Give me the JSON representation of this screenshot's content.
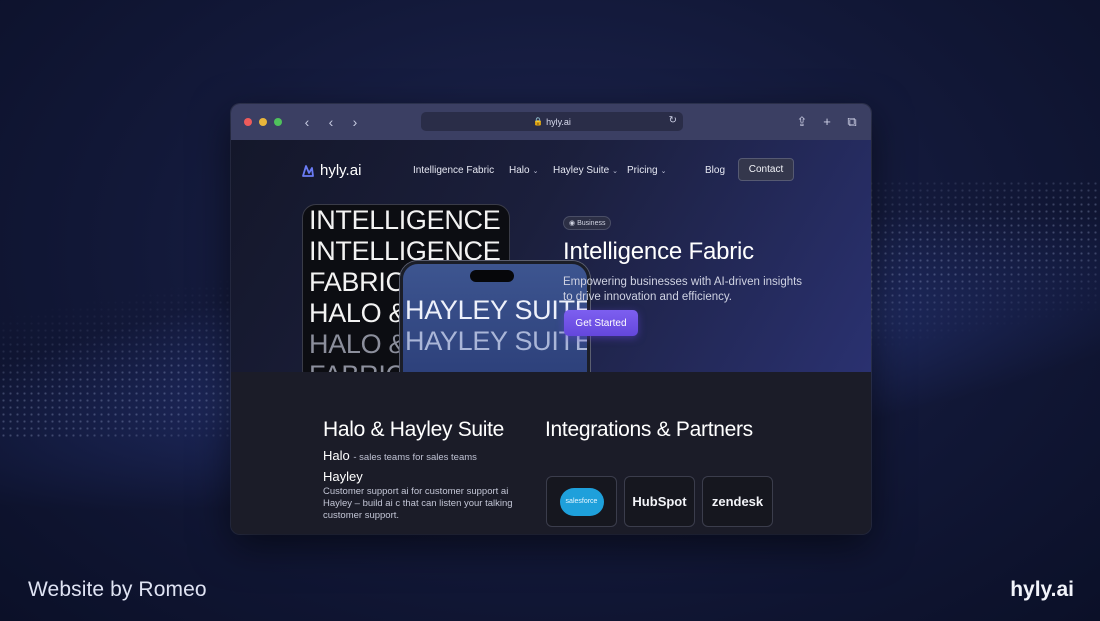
{
  "footer": {
    "credit": "Website by Romeo",
    "brand": "hyly.ai"
  },
  "browser": {
    "url": "hyly.ai",
    "controls": {
      "back": "‹",
      "prev": "‹",
      "next": "›",
      "reload": "↻",
      "share": "⇪",
      "new_tab": "+",
      "tabs": "⧉"
    }
  },
  "site": {
    "logo": "hyly.ai",
    "nav": {
      "items": [
        {
          "label": "Intelligence Fabric",
          "dropdown": false
        },
        {
          "label": "Halo",
          "dropdown": true
        },
        {
          "label": "Hayley Suite",
          "dropdown": true
        },
        {
          "label": "Pricing",
          "dropdown": true
        }
      ],
      "blog": "Blog",
      "contact": "Contact"
    },
    "hero": {
      "big_text": [
        "INTELLIGENCE",
        "INTELLIGENCE",
        "FABRIC",
        "HALO &",
        "HALO &",
        "FABRIC"
      ],
      "phone_text": [
        "HAYLEY SUITE",
        "HAYLEY SUITE"
      ],
      "badge": "Business",
      "title": "Intelligence Fabric",
      "description": "Empowering businesses with AI-driven insights to drive innovation and efficiency.",
      "cta": "Get Started"
    },
    "suite": {
      "title": "Halo & Hayley Suite",
      "halo_label": "Halo",
      "halo_desc": "- sales teams for sales teams",
      "hayley_label": "Hayley",
      "hayley_desc": "Customer support ai for customer support ai Hayley – build ai c that can listen your talking customer support."
    },
    "integrations": {
      "title": "Integrations & Partners",
      "partners": [
        {
          "name": "salesforce"
        },
        {
          "name": "HubSpot"
        },
        {
          "name": "zendesk"
        }
      ]
    }
  },
  "colors": {
    "accent": "#6d4fe6",
    "background": "#121838",
    "titlebar": "#3b3f63"
  }
}
